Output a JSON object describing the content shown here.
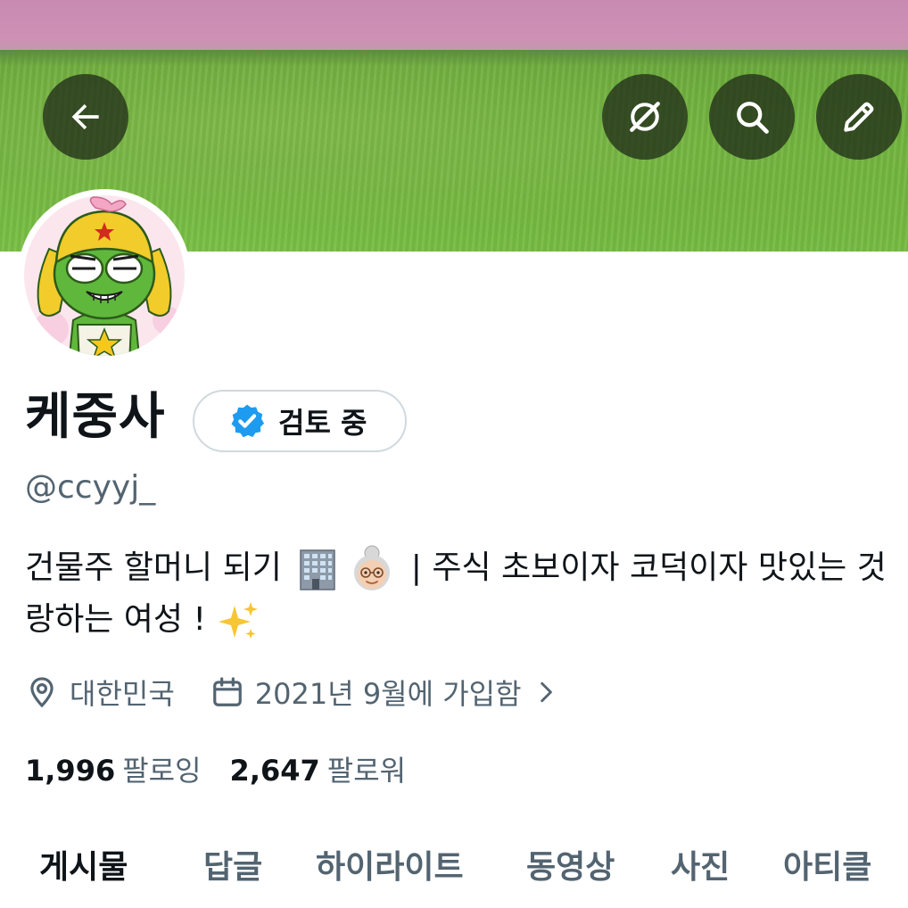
{
  "header": {
    "back_icon": "arrow-left-icon",
    "actions": [
      {
        "name": "grok-icon"
      },
      {
        "name": "search-icon"
      },
      {
        "name": "edit-icon"
      }
    ]
  },
  "profile": {
    "display_name": "케중사",
    "verification_status": "검토 중",
    "handle": "@ccyyj_",
    "bio_line1_a": "건물주 할머니 되기",
    "bio_line1_b": "| 주식 초보이자 코덕이자 맛있는 것",
    "bio_line2": "랑하는 여성 !",
    "location": "대한민국",
    "joined": "2021년 9월에 가입함",
    "following_count": "1,996",
    "following_label": "팔로잉",
    "followers_count": "2,647",
    "followers_label": "팔로워"
  },
  "tabs": [
    "게시물",
    "답글",
    "하이라이트",
    "동영상",
    "사진",
    "아티클"
  ],
  "colors": {
    "verify_blue": "#1d9bf0",
    "secondary_text": "#536471",
    "primary_text": "#0f1419",
    "banner_sky": "#c98db3",
    "banner_grass": "#6fb23e"
  }
}
